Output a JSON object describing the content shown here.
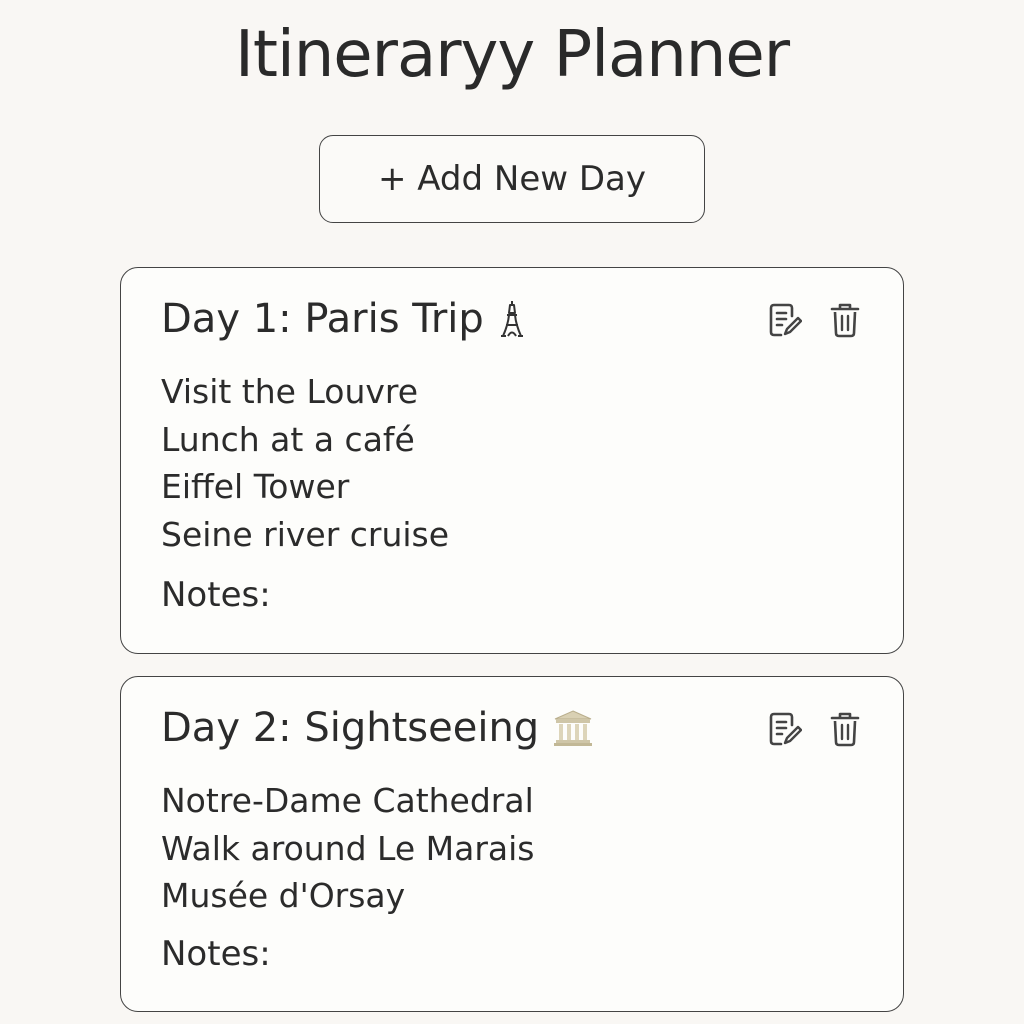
{
  "header": {
    "title": "Itineraryy Planner"
  },
  "toolbar": {
    "add_day_label": "+ Add New Day"
  },
  "days": [
    {
      "title": "Day 1: Paris Trip",
      "emoji_icon": "eiffel-tower-icon",
      "items": [
        "Visit the Louvre",
        "Lunch at a café",
        "Eiffel Tower",
        "Seine river cruise"
      ],
      "notes_label": "Notes:"
    },
    {
      "title": "Day 2: Sightseeing",
      "emoji_icon": "classical-building-icon",
      "items": [
        "Notre-Dame Cathedral",
        "Walk around Le Marais",
        "Musée d'Orsay"
      ],
      "notes_label": "Notes:"
    }
  ],
  "colors": {
    "background": "#f9f7f4",
    "card_background": "#fdfdfb",
    "border": "#444444",
    "text": "#2b2b2b",
    "building_icon": "#cfc6a8"
  }
}
